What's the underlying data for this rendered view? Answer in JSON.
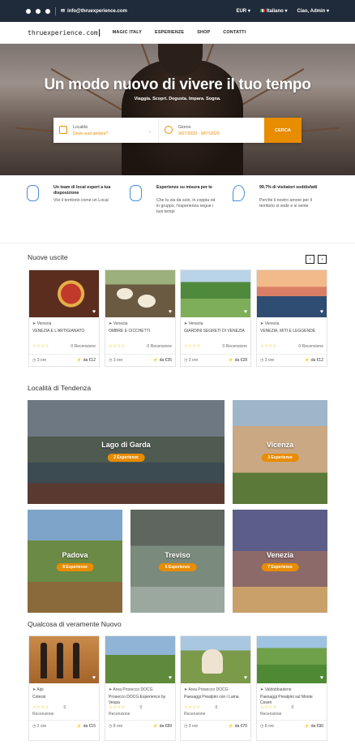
{
  "topbar": {
    "email": "info@thruexperience.com",
    "currency": "EUR",
    "language": "Italiano",
    "greeting": "Ciao, Admin"
  },
  "nav": {
    "logo": "thruexperience.com",
    "items": [
      "MAGIC ITALY",
      "ESPERIENZE",
      "SHOP",
      "CONTATTI"
    ]
  },
  "hero": {
    "title": "Un modo nuovo di vivere il tuo tempo",
    "subtitle": "Viaggia. Scopri. Degusta. Impara. Sogna.",
    "search": {
      "location_label": "Località",
      "location_placeholder": "Dove vuoi andare?",
      "date_label": "Giorno",
      "date_value": "9/07/2020 - 9/07/2020",
      "button": "CERCA"
    }
  },
  "features": [
    {
      "title": "Un team di local expert a tua disposizione",
      "text": "Vivi il territorio come un Local"
    },
    {
      "title": "Esperienze su misura per te",
      "text": "Che tu sia da solo, in coppia od in gruppo, l'esperienza segue i tuoi tempi"
    },
    {
      "title": "99.7% di visitatori soddisfatti",
      "text": "Perché il nostro amore per il territorio si vede e si sente"
    }
  ],
  "nuove_uscite": {
    "title": "Nuove uscite",
    "cards": [
      {
        "location": "Venezia",
        "title": "VENEZIA E L'ARTIGIANATO",
        "stars": "☆☆☆☆",
        "reviews": "0 Recensione",
        "duration": "3 ore",
        "price": "da €12",
        "img": "craft"
      },
      {
        "location": "Venezia",
        "title": "OMBRE E CICCHETTI",
        "stars": "☆☆☆☆",
        "reviews": "0 Recensione",
        "duration": "3 ore",
        "price": "da €35",
        "img": "food"
      },
      {
        "location": "Venezia",
        "title": "GIARDINI SEGRETI DI VENEZIA",
        "stars": "☆☆☆☆",
        "reviews": "0 Recensione",
        "duration": "3 ore",
        "price": "da €28",
        "img": "garden"
      },
      {
        "location": "Venezia",
        "title": "VENEZIA, MITI E LEGGENDE",
        "stars": "☆☆☆☆",
        "reviews": "0 Recensione",
        "duration": "3 ore",
        "price": "da €12",
        "img": "canal"
      }
    ]
  },
  "tendenza": {
    "title": "Località di Tendenza",
    "destinations": [
      {
        "name": "Lago di Garda",
        "badge": "2 Esperienze"
      },
      {
        "name": "Vicenza",
        "badge": "3 Esperienze"
      },
      {
        "name": "Padova",
        "badge": "8 Esperienze"
      },
      {
        "name": "Treviso",
        "badge": "6 Esperienze"
      },
      {
        "name": "Venezia",
        "badge": "7 Esperienze"
      }
    ]
  },
  "nuovo": {
    "title": "Qualcosa di veramente Nuovo",
    "cards": [
      {
        "location": "Alpi",
        "title": "Colessi",
        "stars": "☆☆☆☆",
        "reviews_num": "0",
        "reviews_label": "Recensione",
        "duration": "2 ore",
        "price": "da €15"
      },
      {
        "location": "Area Prosecco DOCG",
        "title": "Prosecco DOCG Experience by Vespa",
        "stars": "☆☆☆☆",
        "reviews_num": "0",
        "reviews_label": "Recensione",
        "duration": "8 ore",
        "price": "da €89"
      },
      {
        "location": "Area Prosecco DOCG",
        "title": "Paesaggi Prealpini con i Lama",
        "stars": "☆☆☆☆",
        "reviews_num": "0",
        "reviews_label": "Recensione",
        "duration": "3 ore",
        "price": "da €70"
      },
      {
        "location": "Valdobbiadene",
        "title": "Paesaggi Prealpini sul Monte Cesen",
        "stars": "☆☆☆☆",
        "reviews_num": "0",
        "reviews_label": "Recensione",
        "duration": "8 ore",
        "price": "da €90"
      }
    ]
  },
  "colors": {
    "accent": "#e88c00",
    "topbar": "#1f2b3a",
    "icon_blue": "#4a90d9"
  }
}
